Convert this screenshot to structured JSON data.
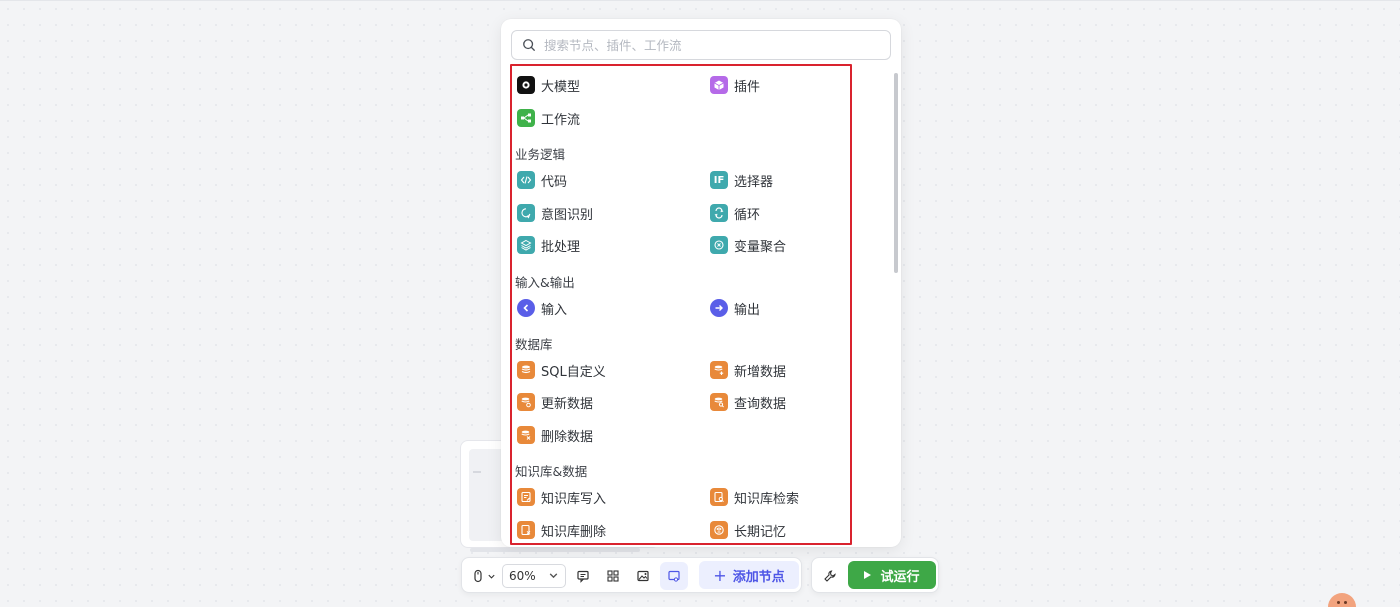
{
  "search": {
    "placeholder": "搜索节点、插件、工作流"
  },
  "top_nodes": [
    {
      "label": "大模型",
      "icon": "llm-icon",
      "color": "#111111"
    },
    {
      "label": "插件",
      "icon": "plugin-icon",
      "color": "#b56ae8"
    },
    {
      "label": "工作流",
      "icon": "workflow-icon",
      "color": "#3fb24a"
    }
  ],
  "sections": [
    {
      "title": "业务逻辑",
      "items": [
        {
          "label": "代码",
          "icon": "code-icon",
          "color": "#3fa9ad"
        },
        {
          "label": "选择器",
          "icon": "if-icon",
          "color": "#3fa9ad"
        },
        {
          "label": "意图识别",
          "icon": "intent-icon",
          "color": "#3fa9ad"
        },
        {
          "label": "循环",
          "icon": "loop-icon",
          "color": "#3fa9ad"
        },
        {
          "label": "批处理",
          "icon": "batch-icon",
          "color": "#3fa9ad"
        },
        {
          "label": "变量聚合",
          "icon": "variable-merge-icon",
          "color": "#3fa9ad"
        }
      ]
    },
    {
      "title": "输入&输出",
      "items": [
        {
          "label": "输入",
          "icon": "input-icon",
          "color": "#5a5ee8"
        },
        {
          "label": "输出",
          "icon": "output-icon",
          "color": "#5a5ee8"
        }
      ]
    },
    {
      "title": "数据库",
      "items": [
        {
          "label": "SQL自定义",
          "icon": "database-sql-icon",
          "color": "#e8893a"
        },
        {
          "label": "新增数据",
          "icon": "database-add-icon",
          "color": "#e8893a"
        },
        {
          "label": "更新数据",
          "icon": "database-update-icon",
          "color": "#e8893a"
        },
        {
          "label": "查询数据",
          "icon": "database-query-icon",
          "color": "#e8893a"
        },
        {
          "label": "删除数据",
          "icon": "database-delete-icon",
          "color": "#e8893a"
        }
      ]
    },
    {
      "title": "知识库&数据",
      "items": [
        {
          "label": "知识库写入",
          "icon": "knowledge-write-icon",
          "color": "#e8893a"
        },
        {
          "label": "知识库检索",
          "icon": "knowledge-search-icon",
          "color": "#e8893a"
        },
        {
          "label": "知识库删除",
          "icon": "knowledge-delete-icon",
          "color": "#e8893a"
        },
        {
          "label": "长期记忆",
          "icon": "long-term-memory-icon",
          "color": "#e8893a"
        }
      ]
    }
  ],
  "toolbar": {
    "zoom": "60%",
    "add_node_label": "添加节点",
    "add_node_plus": "+",
    "run_label": "试运行"
  },
  "colors": {
    "highlight": "#d9232e",
    "accent": "#4e56e6",
    "run": "#3ea847"
  }
}
